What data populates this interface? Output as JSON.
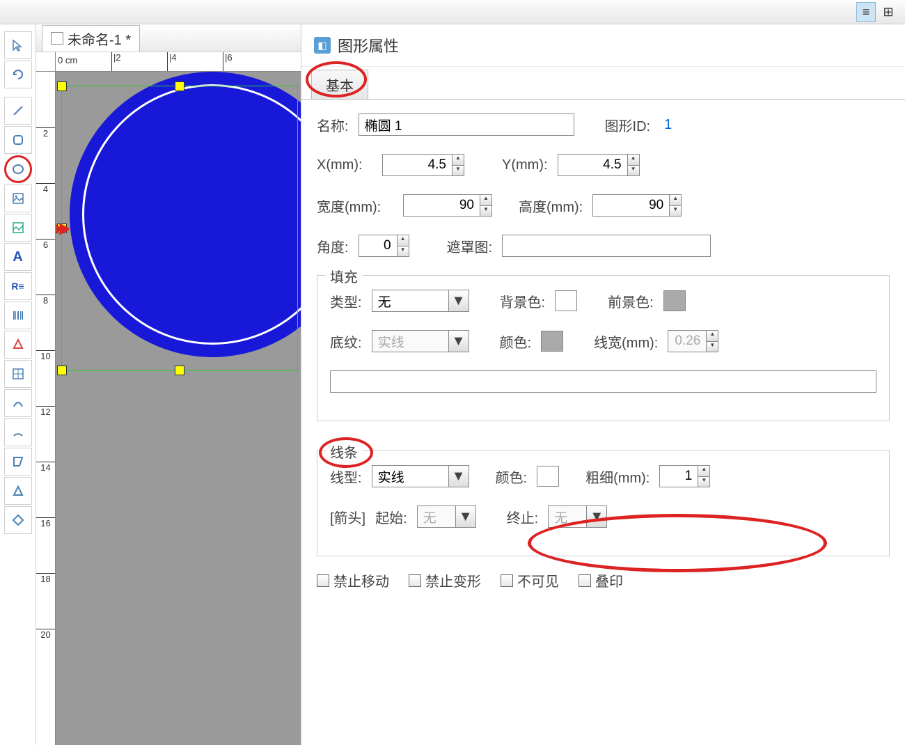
{
  "document": {
    "tab_title": "未命名-1 *"
  },
  "ruler": {
    "unit": "0 cm",
    "h_ticks": [
      "|2",
      "|4",
      "|6"
    ],
    "v_ticks": [
      "2",
      "4",
      "6",
      "8",
      "10",
      "12",
      "14",
      "16",
      "18",
      "20"
    ]
  },
  "panel": {
    "title": "图形属性",
    "tab_basic": "基本",
    "name_label": "名称:",
    "name_value": "椭圆 1",
    "shape_id_label": "图形ID:",
    "shape_id_value": "1",
    "x_label": "X(mm):",
    "x_value": "4.5",
    "y_label": "Y(mm):",
    "y_value": "4.5",
    "width_label": "宽度(mm):",
    "width_value": "90",
    "height_label": "高度(mm):",
    "height_value": "90",
    "angle_label": "角度:",
    "angle_value": "0",
    "mask_label": "遮罩图:",
    "fill": {
      "title": "填充",
      "type_label": "类型:",
      "type_value": "无",
      "bgcolor_label": "背景色:",
      "fgcolor_label": "前景色:",
      "pattern_label": "底纹:",
      "pattern_value": "实线",
      "color_label": "颜色:",
      "linewidth_label": "线宽(mm):",
      "linewidth_value": "0.26"
    },
    "line": {
      "title": "线条",
      "type_label": "线型:",
      "type_value": "实线",
      "color_label": "颜色:",
      "thickness_label": "粗细(mm):",
      "thickness_value": "1",
      "arrow_prefix": "[箭头]",
      "start_label": "起始:",
      "start_value": "无",
      "end_label": "终止:",
      "end_value": "无"
    },
    "checks": {
      "no_move": "禁止移动",
      "no_transform": "禁止变形",
      "invisible": "不可见",
      "overprint": "叠印"
    }
  }
}
